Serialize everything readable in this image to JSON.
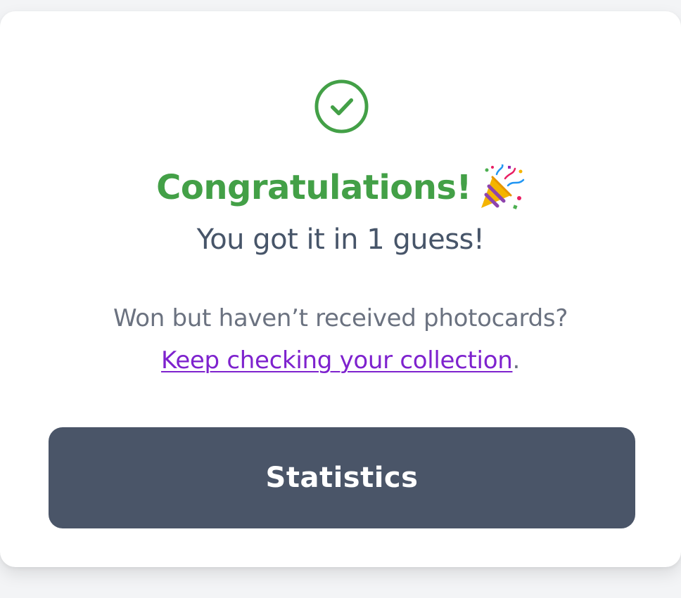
{
  "result": {
    "icon": "check-circle-icon",
    "title": "Congratulations!",
    "title_emoji_icon": "party-popper-icon",
    "subtitle": "You got it in 1 guess!"
  },
  "info": {
    "text": "Won but haven’t received photocards?",
    "link_label": "Keep checking your collection",
    "trailing": "."
  },
  "actions": {
    "statistics_label": "Statistics"
  },
  "colors": {
    "success": "#43a047",
    "link": "#7e22ce",
    "button": "#4a5568"
  }
}
